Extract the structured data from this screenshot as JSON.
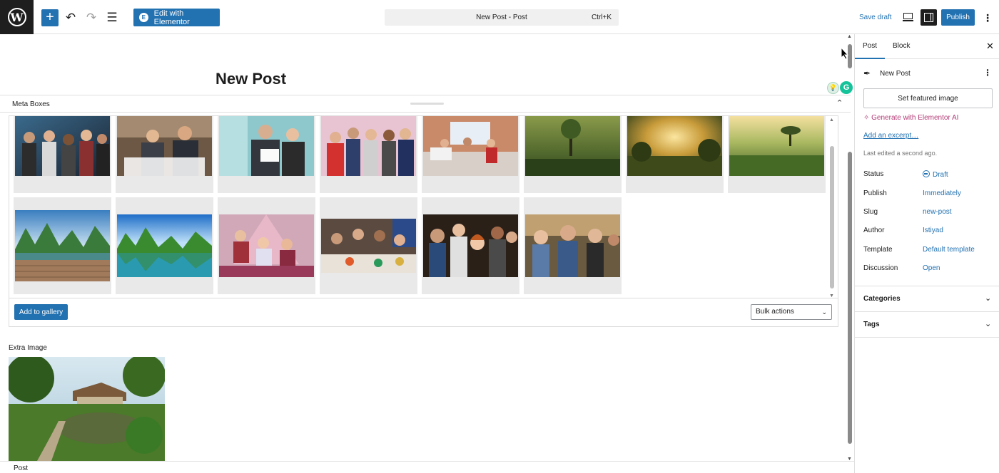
{
  "topbar": {
    "logo_glyph": "W",
    "add_glyph": "+",
    "undo_glyph": "↶",
    "redo_glyph": "↷",
    "outline_glyph": "☰",
    "elementor_badge": "E",
    "elementor_label": "Edit with Elementor",
    "command_title": "New Post - Post",
    "command_shortcut": "Ctrl+K",
    "save_draft": "Save draft",
    "publish": "Publish",
    "more_glyph": "⋮"
  },
  "editor": {
    "post_title": "New Post",
    "meta_boxes_label": "Meta Boxes",
    "collapse_glyph": "⌃",
    "add_to_gallery": "Add to gallery",
    "bulk_actions": "Bulk actions",
    "caret_glyph": "⌄",
    "extra_image_label": "Extra Image",
    "breadcrumb": "Post",
    "gallery_images": [
      "people-dancing-party",
      "business-meeting-laptop",
      "business-documents-review",
      "friends-toast-party",
      "office-team-lounge",
      "misty-forest",
      "sunrise-forest",
      "green-valley-sunrise",
      "karst-river-boardwalk",
      "karst-lake-blue-sky",
      "kids-christmas-tree",
      "family-dinner-table",
      "friends-selfie",
      "friends-laughing"
    ]
  },
  "sidebar": {
    "tabs": [
      "Post",
      "Block"
    ],
    "close_glyph": "✕",
    "post_icon_glyph": "✒",
    "post_name": "New Post",
    "dots_glyph": "⋮",
    "featured_image": "Set featured image",
    "generate_ai": "✧ Generate with Elementor AI",
    "add_excerpt": "Add an excerpt…",
    "last_edited": "Last edited a second ago.",
    "properties": [
      {
        "key": "Status",
        "value": "Draft"
      },
      {
        "key": "Publish",
        "value": "Immediately"
      },
      {
        "key": "Slug",
        "value": "new-post"
      },
      {
        "key": "Author",
        "value": "Istiyad"
      },
      {
        "key": "Template",
        "value": "Default template"
      },
      {
        "key": "Discussion",
        "value": "Open"
      }
    ],
    "sections": [
      "Categories",
      "Tags"
    ],
    "chevron_glyph": "⌄"
  },
  "colors": {
    "accent": "#2271b1",
    "ai_pink": "#b33a75",
    "dark": "#1e1e1e"
  }
}
